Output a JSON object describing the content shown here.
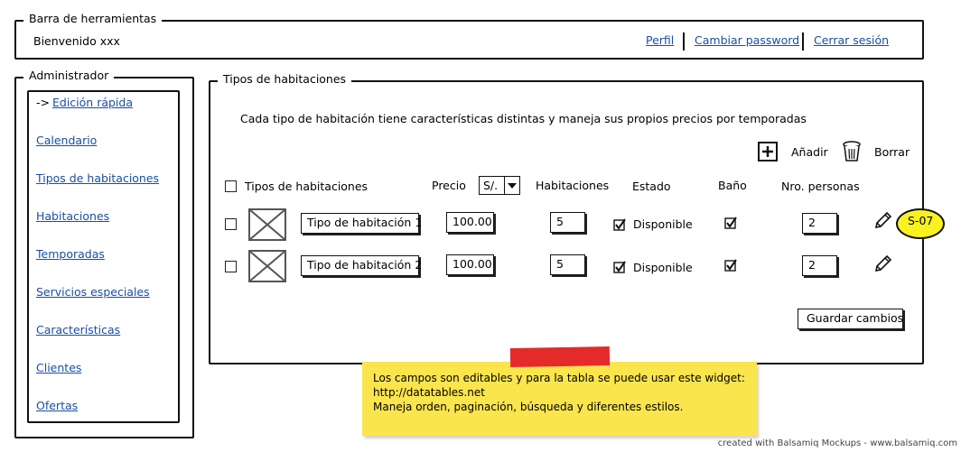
{
  "toolbar": {
    "legend": "Barra de herramientas",
    "welcome": "Bienvenido xxx",
    "links": [
      "Perfil",
      "Cambiar password",
      "Cerrar sesión"
    ]
  },
  "sidebar": {
    "legend": "Administrador",
    "arrow": "->",
    "items": [
      {
        "label": "Edición rápida"
      },
      {
        "label": "Calendario"
      },
      {
        "label": "Tipos de habitaciones"
      },
      {
        "label": "Habitaciones"
      },
      {
        "label": "Temporadas"
      },
      {
        "label": "Servicios especiales"
      },
      {
        "label": "Características"
      },
      {
        "label": "Clientes"
      },
      {
        "label": "Ofertas"
      }
    ]
  },
  "main": {
    "legend": "Tipos de habitaciones",
    "description": "Cada tipo de habitación tiene características distintas y maneja sus propios precios por temporadas",
    "add_label": "Añadir",
    "delete_label": "Borrar",
    "columns": {
      "name": "Tipos de habitaciones",
      "price": "Precio",
      "currency": "S/.",
      "rooms": "Habitaciones",
      "status": "Estado",
      "bath": "Baño",
      "persons": "Nro. personas"
    },
    "rows": [
      {
        "name": "Tipo de habitación 1",
        "price": "100.00",
        "rooms": "5",
        "status": "Disponible",
        "persons": "2"
      },
      {
        "name": "Tipo de habitación 2",
        "price": "100.00",
        "rooms": "5",
        "status": "Disponible",
        "persons": "2"
      }
    ],
    "save_label": "Guardar cambios",
    "badge": "S-07"
  },
  "note": {
    "line1": "Los campos son editables y para la tabla se puede usar este widget:",
    "line2": "http://datatables.net",
    "line3": "Maneja orden, paginación, búsqueda y diferentes estilos."
  },
  "footer": "created with Balsamiq Mockups - www.balsamiq.com",
  "colors": {
    "link": "#1a4fa0",
    "note_bg": "#fbe54d",
    "badge_bg": "#f8f220",
    "tape": "#e52a2a"
  }
}
